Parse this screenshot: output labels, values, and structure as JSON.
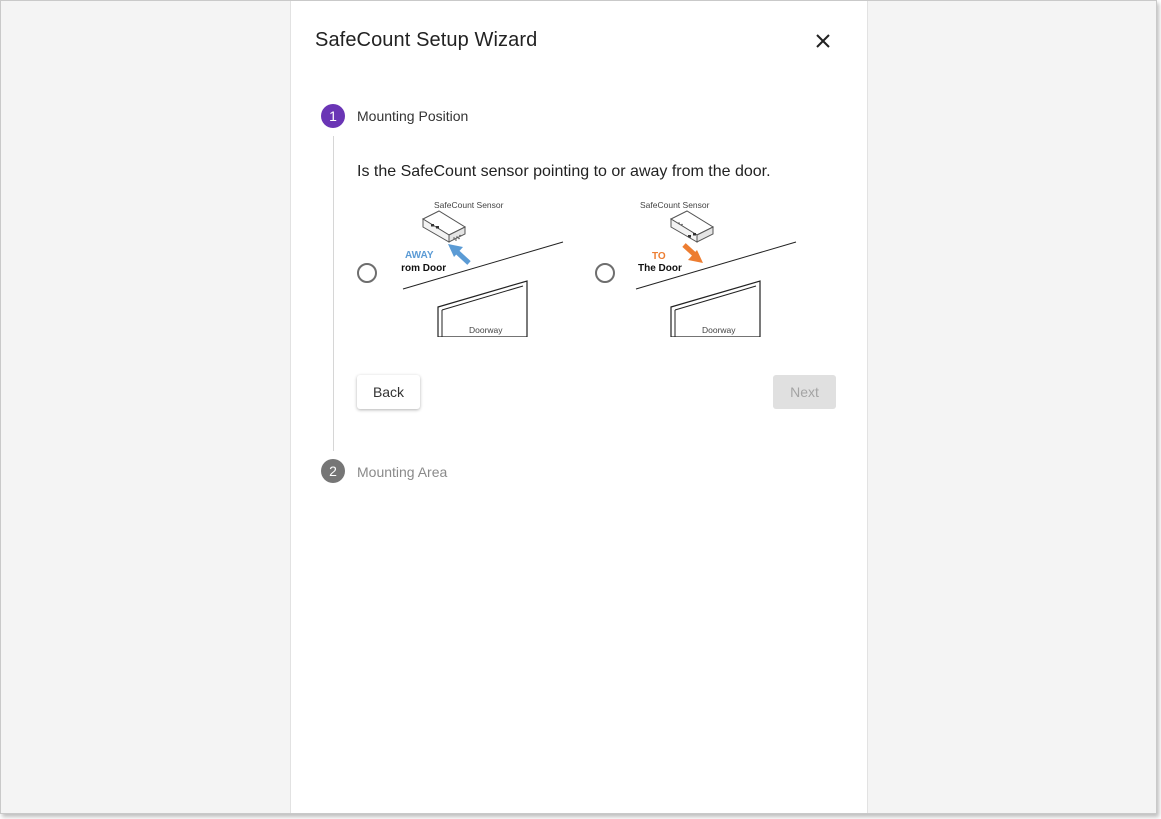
{
  "wizard": {
    "title": "SafeCount Setup Wizard",
    "close_icon": "close-icon"
  },
  "steps": [
    {
      "number": "1",
      "label": "Mounting Position",
      "active": true
    },
    {
      "number": "2",
      "label": "Mounting Area",
      "active": false
    }
  ],
  "question": "Is the SafeCount sensor pointing to or away from the door.",
  "options": {
    "away": {
      "sensor_label": "SafeCount Sensor",
      "direction_word": "AWAY",
      "direction_rest": "From Door",
      "doorway_label": "Doorway",
      "accent_color": "#5b9bd5"
    },
    "to": {
      "sensor_label": "SafeCount Sensor",
      "direction_word": "TO",
      "direction_rest": "The Door",
      "doorway_label": "Doorway",
      "accent_color": "#ed7d31"
    }
  },
  "buttons": {
    "back": "Back",
    "next": "Next"
  },
  "colors": {
    "step_active": "#6a35b5",
    "step_inactive": "#767676"
  }
}
